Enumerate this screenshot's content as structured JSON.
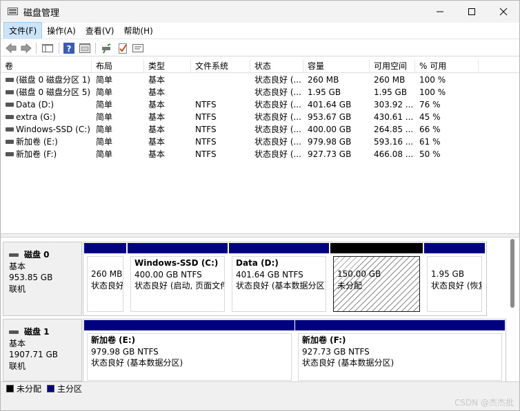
{
  "window": {
    "title": "磁盘管理",
    "minimize_icon": "minimize-icon",
    "maximize_icon": "maximize-icon",
    "close_icon": "close-icon"
  },
  "menu": [
    "文件(F)",
    "操作(A)",
    "查看(V)",
    "帮助(H)"
  ],
  "toolbar": [
    "back-arrow-icon",
    "forward-arrow-icon",
    "console-tree-icon",
    "help-icon",
    "properties-icon",
    "connect-icon",
    "check-icon",
    "list-icon"
  ],
  "list": {
    "columns": [
      "卷",
      "布局",
      "类型",
      "文件系统",
      "状态",
      "容量",
      "可用空间",
      "% 可用"
    ],
    "rows": [
      [
        "(磁盘 0 磁盘分区 1)",
        "简单",
        "基本",
        "",
        "状态良好 (...",
        "260 MB",
        "260 MB",
        "100 %"
      ],
      [
        "(磁盘 0 磁盘分区 5)",
        "简单",
        "基本",
        "",
        "状态良好 (...",
        "1.95 GB",
        "1.95 GB",
        "100 %"
      ],
      [
        "Data (D:)",
        "简单",
        "基本",
        "NTFS",
        "状态良好 (...",
        "401.64 GB",
        "303.92 ...",
        "76 %"
      ],
      [
        "extra (G:)",
        "简单",
        "基本",
        "NTFS",
        "状态良好 (...",
        "953.67 GB",
        "430.61 ...",
        "45 %"
      ],
      [
        "Windows-SSD (C:)",
        "简单",
        "基本",
        "NTFS",
        "状态良好 (...",
        "400.00 GB",
        "264.85 ...",
        "66 %"
      ],
      [
        "新加卷 (E:)",
        "简单",
        "基本",
        "NTFS",
        "状态良好 (...",
        "979.98 GB",
        "593.16 ...",
        "61 %"
      ],
      [
        "新加卷 (F:)",
        "简单",
        "基本",
        "NTFS",
        "状态良好 (...",
        "927.73 GB",
        "466.08 ...",
        "50 %"
      ]
    ]
  },
  "disks": [
    {
      "name": "磁盘 0",
      "type": "基本",
      "size": "953.85 GB",
      "status": "联机",
      "partitions": [
        {
          "title": "",
          "size": "260 MB",
          "status": "状态良好"
        },
        {
          "title": "Windows-SSD  (C:)",
          "size": "400.00 GB NTFS",
          "status": "状态良好 (启动, 页面文件"
        },
        {
          "title": "Data  (D:)",
          "size": "401.64 GB NTFS",
          "status": "状态良好 (基本数据分区)"
        },
        {
          "title": "",
          "size": "150.00 GB",
          "status": "未分配"
        },
        {
          "title": "",
          "size": "1.95 GB",
          "status": "状态良好 (恢复"
        }
      ]
    },
    {
      "name": "磁盘 1",
      "type": "基本",
      "size": "1907.71 GB",
      "status": "联机",
      "partitions": [
        {
          "title": "新加卷  (E:)",
          "size": "979.98 GB NTFS",
          "status": "状态良好 (基本数据分区)"
        },
        {
          "title": "新加卷  (F:)",
          "size": "927.73 GB NTFS",
          "status": "状态良好 (基本数据分区)"
        }
      ]
    }
  ],
  "legend": [
    {
      "label": "未分配",
      "color": "#000000"
    },
    {
      "label": "主分区",
      "color": "#000080"
    }
  ],
  "watermark": "CSDN @杰杰批"
}
